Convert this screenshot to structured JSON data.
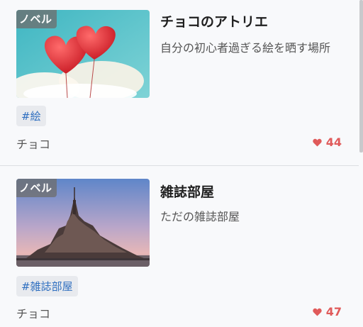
{
  "posts": [
    {
      "badge": "ノベル",
      "title": "チョコのアトリエ",
      "description": "自分の初心者過ぎる絵を晒す場所",
      "tag": "#絵",
      "author": "チョコ",
      "likes": "44",
      "thumbnail_icon": "balloons-image"
    },
    {
      "badge": "ノベル",
      "title": "雑誌部屋",
      "description": "ただの雑誌部屋",
      "tag": "#雑誌部屋",
      "author": "チョコ",
      "likes": "47",
      "thumbnail_icon": "castle-island-image"
    }
  ],
  "colors": {
    "background": "#f8f9fb",
    "tag_text": "#2f6fc0",
    "tag_bg": "#e8eaee",
    "like": "#e05a5a"
  }
}
